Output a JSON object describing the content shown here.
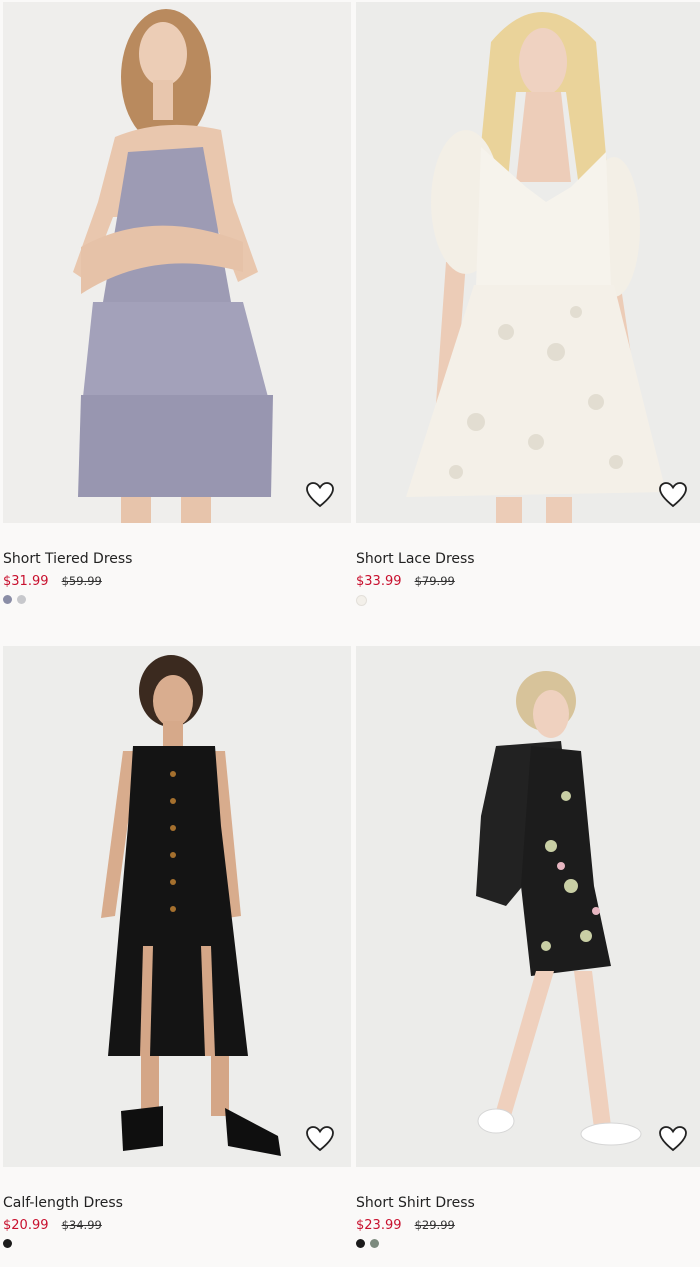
{
  "products": [
    {
      "title": "Short Tiered Dress",
      "sale_price": "$31.99",
      "original_price": "$59.99",
      "swatches": [
        "#8a8da6",
        "#c7c8cc"
      ],
      "dress_color": "#9d9bb4",
      "favorite_icon": "heart-outline-icon"
    },
    {
      "title": "Short Lace Dress",
      "sale_price": "$33.99",
      "original_price": "$79.99",
      "swatches": [
        "#f3f0ea"
      ],
      "dress_color": "#f6f3ec",
      "favorite_icon": "heart-outline-icon"
    },
    {
      "title": "Calf-length Dress",
      "sale_price": "$20.99",
      "original_price": "$34.99",
      "swatches": [
        "#1b1b1b"
      ],
      "dress_color": "#141414",
      "favorite_icon": "heart-outline-icon"
    },
    {
      "title": "Short Shirt Dress",
      "sale_price": "$23.99",
      "original_price": "$29.99",
      "swatches": [
        "#1b1b1b",
        "#7c8a7e"
      ],
      "dress_color": "#1c1c1c",
      "favorite_icon": "heart-outline-icon"
    }
  ],
  "colors": {
    "sale_price": "#c8102e",
    "background": "#faf9f8",
    "image_background": "#f0efee"
  }
}
